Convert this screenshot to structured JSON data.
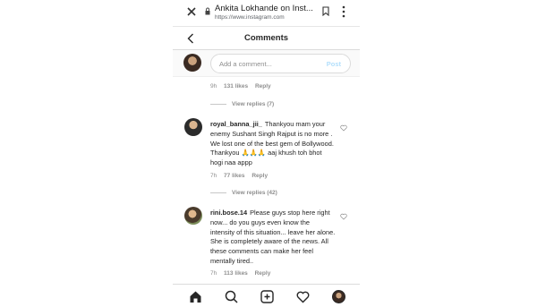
{
  "browser": {
    "title": "Ankita Lokhande on Inst...",
    "url": "https://www.instagram.com"
  },
  "header": {
    "title": "Comments"
  },
  "add_comment": {
    "placeholder": "Add a comment...",
    "post_label": "Post"
  },
  "top_meta": {
    "time": "9h",
    "likes": "131 likes",
    "reply": "Reply"
  },
  "view_replies_1": "View replies (7)",
  "comments": [
    {
      "username": "royal_banna_jii_",
      "text": "Thankyou mam your enemy Sushant Singh Rajput is no more . We lost one of the best gem of Bollywood. Thankyou 🙏🙏🙏 aaj khush toh bhot hogi naa appp",
      "time": "7h",
      "likes": "77 likes",
      "reply": "Reply",
      "view_replies": "View replies (42)"
    },
    {
      "username": "rini.bose.14",
      "text": "Please guys stop here right now... do you guys even know the intensity of this situation... leave her alone. She is completely aware of the news. All these comments can make her feel mentally tired..",
      "time": "7h",
      "likes": "113 likes",
      "reply": "Reply"
    }
  ],
  "nav": [
    "home-icon",
    "search-icon",
    "new-post-icon",
    "activity-heart-icon",
    "profile-avatar"
  ]
}
